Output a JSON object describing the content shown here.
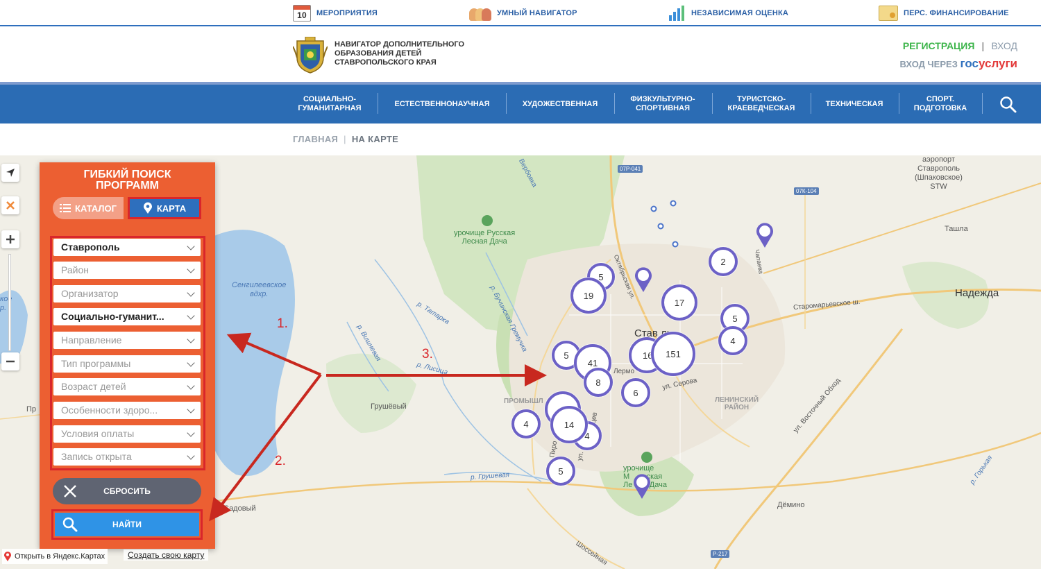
{
  "topbar": {
    "events": {
      "day": "10",
      "label": "МЕРОПРИЯТИЯ"
    },
    "navigator": {
      "label": "УМНЫЙ НАВИГАТОР"
    },
    "assessment": {
      "label": "НЕЗАВИСИМАЯ ОЦЕНКА"
    },
    "financing": {
      "label": "ПЕРС. ФИНАНСИРОВАНИЕ"
    }
  },
  "header": {
    "title_lines": [
      "НАВИГАТОР ДОПОЛНИТЕЛЬНОГО",
      "ОБРАЗОВАНИЯ ДЕТЕЙ",
      "СТАВРОПОЛЬСКОГО КРАЯ"
    ],
    "register": "РЕГИСТРАЦИЯ",
    "separator": "|",
    "login": "ВХОД",
    "login_via": "ВХОД ЧЕРЕЗ",
    "gosuslugi_a": "гос",
    "gosuslugi_b": "услуги"
  },
  "nav": {
    "items": [
      {
        "line1": "СОЦИАЛЬНО-",
        "line2": "ГУМАНИТАРНАЯ"
      },
      {
        "line1": "ЕСТЕСТВЕННОНАУЧНАЯ",
        "line2": ""
      },
      {
        "line1": "ХУДОЖЕСТВЕННАЯ",
        "line2": ""
      },
      {
        "line1": "ФИЗКУЛЬТУРНО-",
        "line2": "СПОРТИВНАЯ"
      },
      {
        "line1": "ТУРИСТСКО-",
        "line2": "КРАЕВЕДЧЕСКАЯ"
      },
      {
        "line1": "ТЕХНИЧЕСКАЯ",
        "line2": ""
      },
      {
        "line1": "СПОРТ.",
        "line2": "ПОДГОТОВКА"
      }
    ]
  },
  "breadcrumb": {
    "home": "ГЛАВНАЯ",
    "sep": "|",
    "current": "НА КАРТЕ"
  },
  "panel": {
    "title_line1": "ГИБКИЙ ПОИСК",
    "title_line2": "ПРОГРАММ",
    "tab_catalog": "КАТАЛОГ",
    "tab_map": "КАРТА",
    "filters": [
      {
        "value": "Ставрополь",
        "filled": true
      },
      {
        "value": "Район",
        "filled": false
      },
      {
        "value": "Организатор",
        "filled": false
      },
      {
        "value": "Социально-гуманит...",
        "filled": true
      },
      {
        "value": "Направление",
        "filled": false
      },
      {
        "value": "Тип программы",
        "filled": false
      },
      {
        "value": "Возраст детей",
        "filled": false
      },
      {
        "value": "Особенности здоро...",
        "filled": false
      },
      {
        "value": "Условия оплаты",
        "filled": false
      },
      {
        "value": "Запись открыта",
        "filled": false
      }
    ],
    "reset": "СБРОСИТЬ",
    "find": "НАЙТИ"
  },
  "map": {
    "labels": {
      "airport": "аэропорт\nСтаврополь\n(Шпаковское)\nSTW",
      "tashla": "Ташла",
      "nadezhda": "Надежда",
      "reservoir": "Сенгилеевское\nвдхр.",
      "russkaya_dacha": "урочище Русская\nЛесная Дача",
      "grushevy": "Грушёвый",
      "sadovy": "Садовый",
      "demino": "Дёмино",
      "leninsky": "ЛЕНИНСКИЙ\nРАЙОН",
      "promyshl": "ПРОМЫШЛ",
      "mamaiskaya": "урочище\nМ        ская\nЛе        Дача",
      "staromaryevskoe": "Старомарьевское ш.",
      "vostochny": "ул. Восточный Обход",
      "serova": "ул. Серова",
      "tatarka": "р. Татарка",
      "grushevaya": "р. Грушевая",
      "vishnevaya": "р. Вишневая",
      "bouchinskaya": "р. Бучинская Гремучка",
      "verbovka": "Вербовка",
      "gorkaya": "р. Горькая",
      "shosseynaya": "Шоссейная",
      "stavr_partial": "Став            ль",
      "lermont": "Лермо",
      "oktyabr": "Октябрьская ул.",
      "chapaeva": "Чапаева",
      "edge_a": "кое\nр.",
      "edge_b": "Пр",
      "r_lisitsa": "р. Лисица",
      "pirog": "Пиро",
      "ul_tse": "ул.",
      "tsev": "цев"
    },
    "road_tags": [
      "07Р-041",
      "07К-104",
      "Р-217"
    ],
    "clusters": [
      {
        "count": "19",
        "size": "large"
      },
      {
        "count": "5",
        "size": "medium"
      },
      {
        "count": "17",
        "size": "large"
      },
      {
        "count": "2",
        "size": "medium"
      },
      {
        "count": "5",
        "size": "medium"
      },
      {
        "count": "4",
        "size": "medium"
      },
      {
        "count": "5",
        "size": "medium"
      },
      {
        "count": "41",
        "size": "large"
      },
      {
        "count": "16",
        "size": "large"
      },
      {
        "count": "151",
        "size": "xlarge"
      },
      {
        "count": "8",
        "size": "medium"
      },
      {
        "count": "6",
        "size": "medium"
      },
      {
        "count": "",
        "size": "large"
      },
      {
        "count": "14",
        "size": "large"
      },
      {
        "count": "4",
        "size": "medium"
      },
      {
        "count": "4",
        "size": "medium"
      },
      {
        "count": "5",
        "size": "medium"
      }
    ]
  },
  "annotations": {
    "one": "1.",
    "two": "2.",
    "three": "3."
  },
  "footer": {
    "yandex": "Открыть в Яндекс.Картах",
    "create": "Создать свою карту"
  },
  "colors": {
    "brand_blue": "#2b6cb4",
    "panel_orange": "#ec5f32",
    "annotation_red": "#d9262b",
    "cluster_purple": "#6c61c6",
    "register_green": "#3cb44a"
  }
}
